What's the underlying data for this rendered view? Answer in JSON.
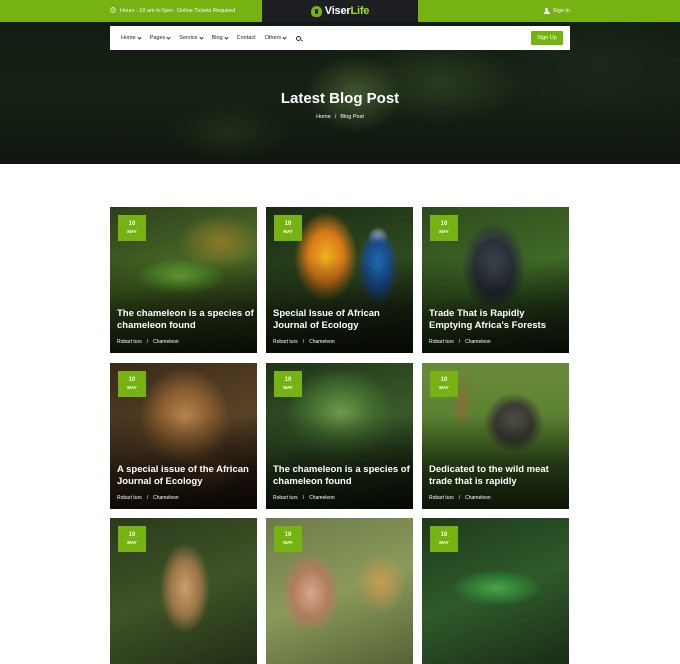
{
  "topbar": {
    "hours_label": "Hours : 10 am to 5pm",
    "tickets": "Online Tickets Required",
    "brand": "Viser",
    "brand_accent": "Life",
    "signin": "Sign In"
  },
  "nav": {
    "items": [
      {
        "label": "Home",
        "dropdown": true
      },
      {
        "label": "Pages",
        "dropdown": true
      },
      {
        "label": "Service",
        "dropdown": true
      },
      {
        "label": "Blog",
        "dropdown": true
      },
      {
        "label": "Contact",
        "dropdown": false
      },
      {
        "label": "Others",
        "dropdown": true
      }
    ],
    "signup": "Sign Up"
  },
  "hero": {
    "title": "Latest Blog Post",
    "breadcrumb_home": "Home",
    "breadcrumb_sep": "/",
    "breadcrumb_current": "Blog Post"
  },
  "posts": [
    {
      "day": "10",
      "month": "MAY",
      "title": "The chameleon is a species of chameleon found",
      "author": "Robart turs",
      "sep": "/",
      "category": "Chameleon",
      "image": "chameleon"
    },
    {
      "day": "10",
      "month": "MAY",
      "title": "Special Issue of African Journal of Ecology",
      "author": "Robart turs",
      "sep": "/",
      "category": "Chameleon",
      "image": "parrot"
    },
    {
      "day": "10",
      "month": "MAY",
      "title": "Trade That is Rapidly Emptying Africa's Forests",
      "author": "Robart turs",
      "sep": "/",
      "category": "Chameleon",
      "image": "chimpanzee"
    },
    {
      "day": "10",
      "month": "MAY",
      "title": "A special issue of the African Journal of Ecology",
      "author": "Robart turs",
      "sep": "/",
      "category": "Chameleon",
      "image": "lioness"
    },
    {
      "day": "10",
      "month": "MAY",
      "title": "The chameleon is a species of chameleon found",
      "author": "Robart turs",
      "sep": "/",
      "category": "Chameleon",
      "image": "iguana"
    },
    {
      "day": "10",
      "month": "MAY",
      "title": "Dedicated to the wild meat trade that is rapidly",
      "author": "Robart turs",
      "sep": "/",
      "category": "Chameleon",
      "image": "safari-jeep"
    },
    {
      "day": "10",
      "month": "MAY",
      "title": "",
      "author": "",
      "sep": "",
      "category": "",
      "image": "giraffe"
    },
    {
      "day": "10",
      "month": "MAY",
      "title": "",
      "author": "",
      "sep": "",
      "category": "",
      "image": "monkey"
    },
    {
      "day": "10",
      "month": "MAY",
      "title": "",
      "author": "",
      "sep": "",
      "category": "",
      "image": "chameleon"
    }
  ],
  "colors": {
    "accent": "#76b312",
    "dark": "#1d1f22"
  }
}
